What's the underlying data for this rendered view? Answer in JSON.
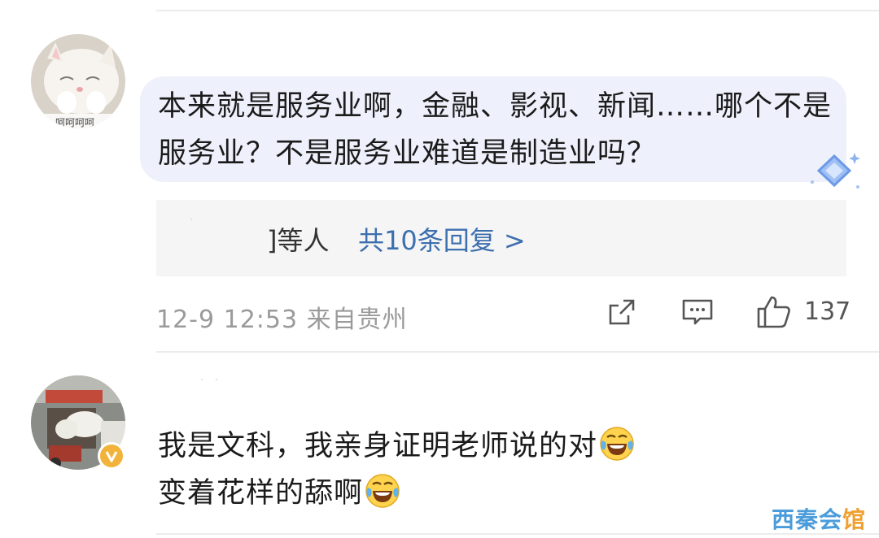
{
  "comments": [
    {
      "text": "本来就是服务业啊，金融、影视、新闻……哪个不是服务业？不是服务业难道是制造业吗？",
      "replies": {
        "names_suffix": "]等人",
        "link": "共10条回复 >"
      },
      "meta": "12-9 12:53 来自贵州",
      "likes": "137",
      "avatar_caption": "呵呵呵呵"
    },
    {
      "text_part1": "我是文科，我亲身证明老师说的对",
      "text_part2": "变着花样的舔啊",
      "emoji": "laughing-crying-emoji"
    }
  ],
  "watermark": {
    "main": "西秦会",
    "accent": "馆"
  },
  "colors": {
    "bubble": "#eef0fb",
    "reply_link": "#3d6fae",
    "meta": "#9a9a9a",
    "verified": "#f2b33a"
  },
  "icons": [
    "share-icon",
    "comment-icon",
    "like-icon",
    "verified-icon",
    "diamond-badge-icon"
  ]
}
